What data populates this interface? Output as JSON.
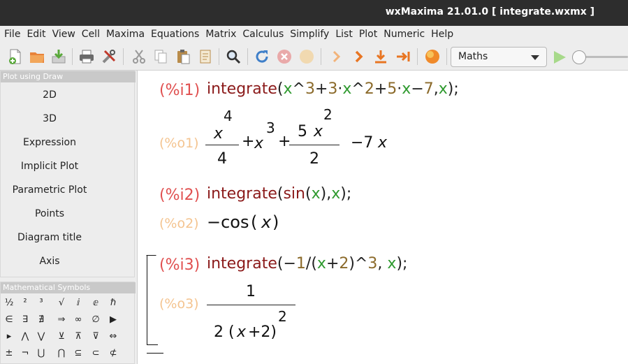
{
  "window": {
    "title": "wxMaxima 21.01.0  [ integrate.wxmx ]"
  },
  "menu": [
    "File",
    "Edit",
    "View",
    "Cell",
    "Maxima",
    "Equations",
    "Matrix",
    "Calculus",
    "Simplify",
    "List",
    "Plot",
    "Numeric",
    "Help"
  ],
  "toolbar": {
    "icons": [
      "new-file-icon",
      "open-file-icon",
      "save-file-icon",
      "print-icon",
      "preferences-icon",
      "cut-icon",
      "copy-icon",
      "paste-icon",
      "select-all-icon",
      "find-icon",
      "restart-icon",
      "interrupt-icon",
      "follow-icon",
      "step-forward-icon",
      "step-fast-icon",
      "step-down-icon",
      "step-to-end-icon",
      "evaluate-all-icon"
    ],
    "mode": "Maths",
    "accent": "#8fd14f"
  },
  "sidebar": {
    "plot_panel_title": "Plot using Draw",
    "plot_items": [
      "2D",
      "3D",
      "Expression",
      "Implicit Plot",
      "Parametric Plot",
      "Points",
      "Diagram title",
      "Axis"
    ],
    "symbols_panel_title": "Mathematical Symbols",
    "symbols": [
      [
        "½",
        "²",
        "³",
        "√",
        "ⅈ",
        "ⅇ",
        "ℏ"
      ],
      [
        "∈",
        "∃",
        "∄",
        "⇒",
        "∞",
        "∅",
        "▶"
      ],
      [
        "▸",
        "⋀",
        "⋁",
        "⊻",
        "⊼",
        "⊽",
        "⇔"
      ],
      [
        "±",
        "¬",
        "⋃",
        "⋂",
        "⊆",
        "⊂",
        "⊄"
      ]
    ]
  },
  "cells": {
    "i1": {
      "label": "(%i1)",
      "fn": "integrate",
      "open": "(",
      "x1": "x",
      "op1": "^",
      "n1": "3",
      "plus1": "+",
      "n2": "3",
      "dot1": "·",
      "x2": "x",
      "op2": "^",
      "n3": "2",
      "plus2": "+",
      "n4": "5",
      "dot2": "·",
      "x3": "x",
      "minus": "−",
      "n5": "7",
      "comma": ",",
      "x4": "x",
      "close": ")",
      "semi": ";"
    },
    "o1": {
      "label": "(%o1)",
      "num1": "x",
      "exp1": "4",
      "den1": "4",
      "plus1": "+",
      "x": "x",
      "exp2": "3",
      "plus2": "+",
      "num2coef": "5",
      "num2var": "x",
      "exp3": "2",
      "den2": "2",
      "tail": "−7",
      "tailvar": "x"
    },
    "i2": {
      "label": "(%i2)",
      "fn": "integrate",
      "open": "(",
      "fn2": "sin",
      "open2": "(",
      "x1": "x",
      "close2": ")",
      "comma": ",",
      "x2": "x",
      "close": ")",
      "semi": ";"
    },
    "o2": {
      "label": "(%o2)",
      "text": "−cos",
      "open": "(",
      "x": "x",
      "close": ")"
    },
    "i3": {
      "label": "(%i3)",
      "fn": "integrate",
      "open": "(",
      "minus": "−",
      "n1": "1",
      "slash": "/(",
      "x1": "x",
      "plus": "+",
      "n2": "2",
      "close1": ")^",
      "n3": "3",
      "comma": ",",
      "x2": "x",
      "close": ")",
      "semi": ";"
    },
    "o3": {
      "label": "(%o3)",
      "num": "1",
      "den_pre": "2 (",
      "den_var": "x",
      "den_post": "+2)",
      "exp": "2"
    }
  }
}
